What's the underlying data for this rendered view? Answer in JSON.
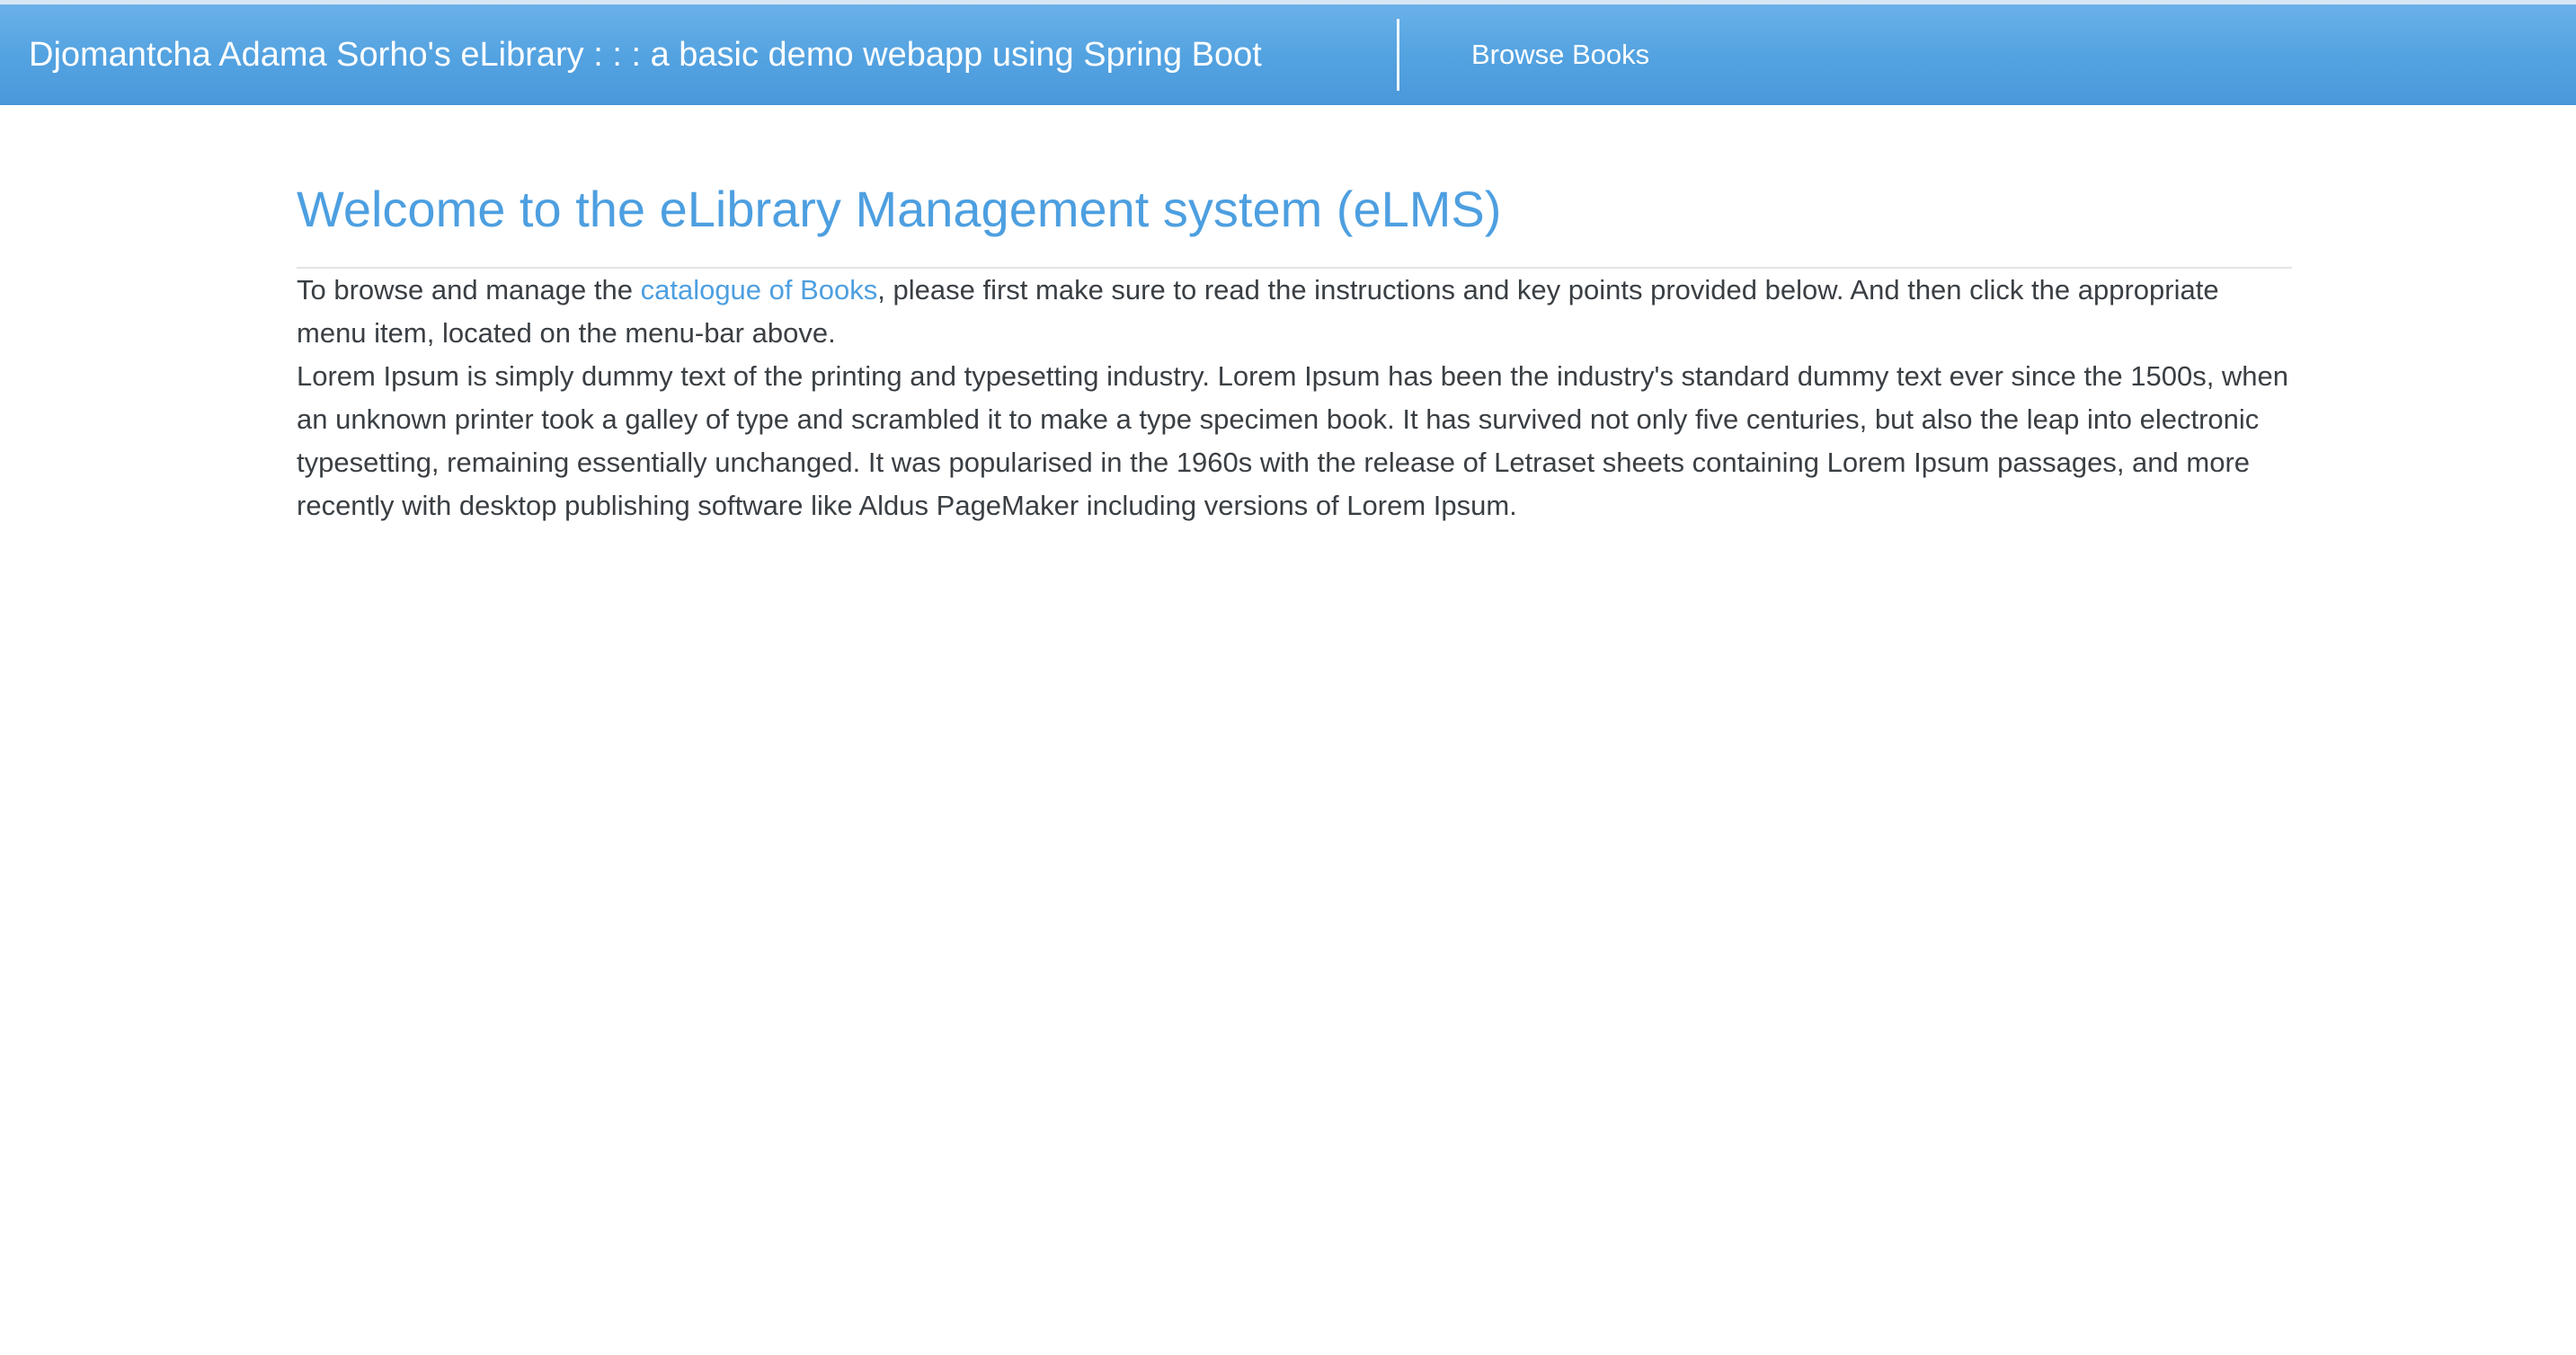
{
  "navbar": {
    "brand": "Djomantcha Adama Sorho's eLibrary : : : a basic demo webapp using Spring Boot",
    "items": [
      {
        "label": "Browse Books"
      }
    ]
  },
  "main": {
    "title": "Welcome to the eLibrary Management system (eLMS)",
    "intro": {
      "before_link": "To browse and manage the ",
      "link_text": "catalogue of Books",
      "after_link": ", please first make sure to read the instructions and key points provided below. And then click the appropriate menu item, located on the menu-bar above."
    },
    "lorem": "Lorem Ipsum is simply dummy text of the printing and typesetting industry. Lorem Ipsum has been the industry's standard dummy text ever since the 1500s, when an unknown printer took a galley of type and scrambled it to make a type specimen book. It has survived not only five centuries, but also the leap into electronic typesetting, remaining essentially unchanged. It was popularised in the 1960s with the release of Letraset sheets containing Lorem Ipsum passages, and more recently with desktop publishing software like Aldus PageMaker including versions of Lorem Ipsum."
  },
  "colors": {
    "navbar_top": "#6bb1e8",
    "navbar_bottom": "#4a98da",
    "accent": "#4d9fe0",
    "text": "#3a3f44"
  }
}
